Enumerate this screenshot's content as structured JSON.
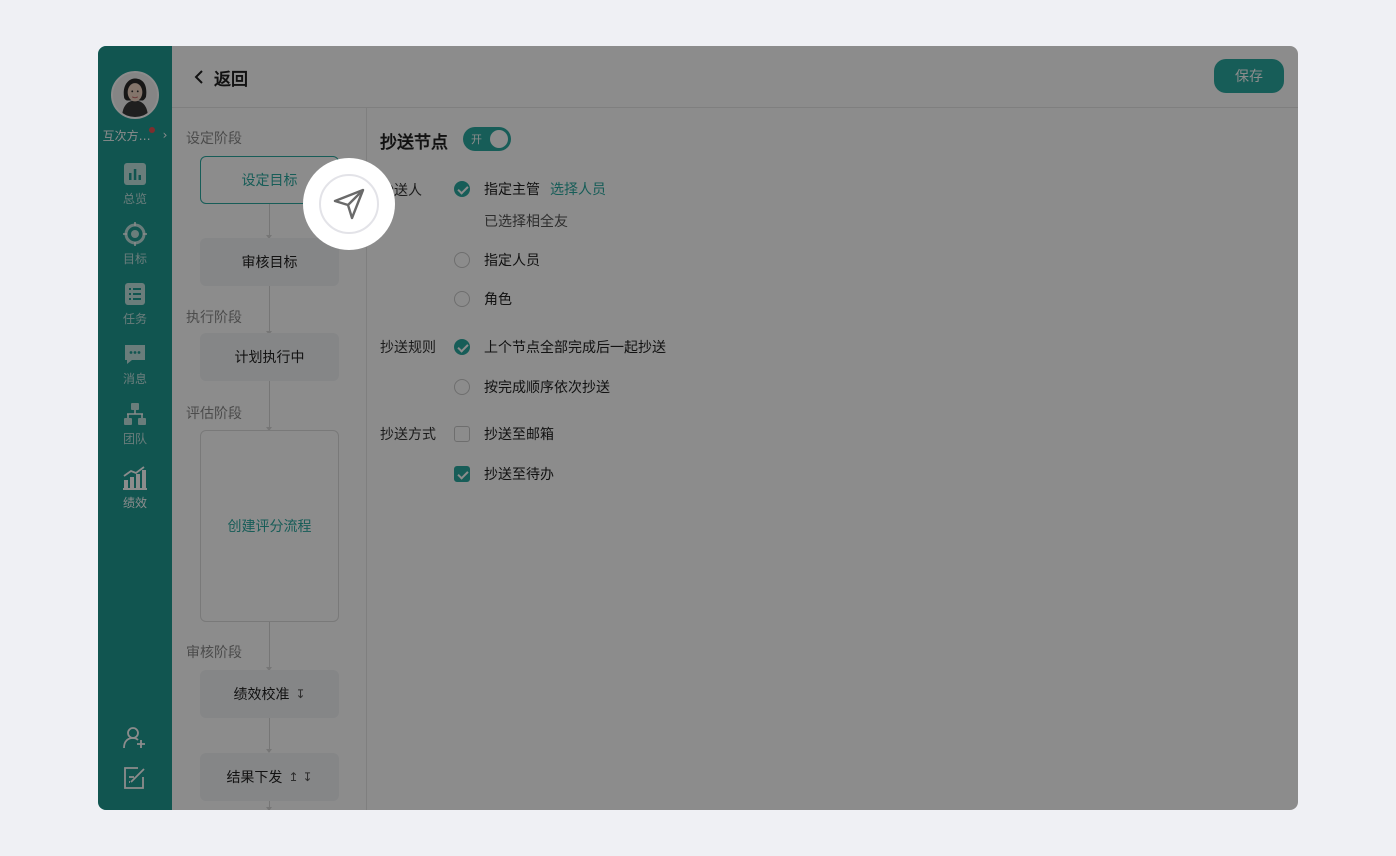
{
  "sidebar": {
    "company_name": "互次方科技",
    "nav": [
      {
        "label": "总览",
        "icon": "chart-icon"
      },
      {
        "label": "目标",
        "icon": "target-icon"
      },
      {
        "label": "任务",
        "icon": "task-list-icon"
      },
      {
        "label": "消息",
        "icon": "message-icon"
      },
      {
        "label": "团队",
        "icon": "team-icon"
      },
      {
        "label": "绩效",
        "icon": "performance-icon"
      }
    ],
    "bottom_icons": [
      "add-user-icon",
      "edit-note-icon"
    ]
  },
  "header": {
    "back_label": "返回",
    "save_label": "保存"
  },
  "flow": {
    "stages": {
      "setup": "设定阶段",
      "execute": "执行阶段",
      "evaluate": "评估阶段",
      "review": "审核阶段"
    },
    "nodes": {
      "set_goal": "设定目标",
      "review_goal": "审核目标",
      "plan_executing": "计划执行中",
      "create_eval": "创建评分流程",
      "calibration": "绩效校准",
      "result_publish": "结果下发"
    },
    "arrows": {
      "down": "↧",
      "up": "↥"
    }
  },
  "main": {
    "section_title": "抄送节点",
    "toggle_label": "开",
    "recipient_label": "抄送人",
    "recipient_options": {
      "manager": "指定主管",
      "select_people": "选择人员",
      "selected_note": "已选择相全友",
      "person": "指定人员",
      "role": "角色"
    },
    "rule_label": "抄送规则",
    "rule_options": {
      "all_done": "上个节点全部完成后一起抄送",
      "sequential": "按完成顺序依次抄送"
    },
    "method_label": "抄送方式",
    "method_options": {
      "email": "抄送至邮箱",
      "todo": "抄送至待办"
    }
  },
  "tour": {
    "icon": "send-icon"
  },
  "colors": {
    "brand": "#209b93",
    "accent": "#2aa9a0"
  }
}
